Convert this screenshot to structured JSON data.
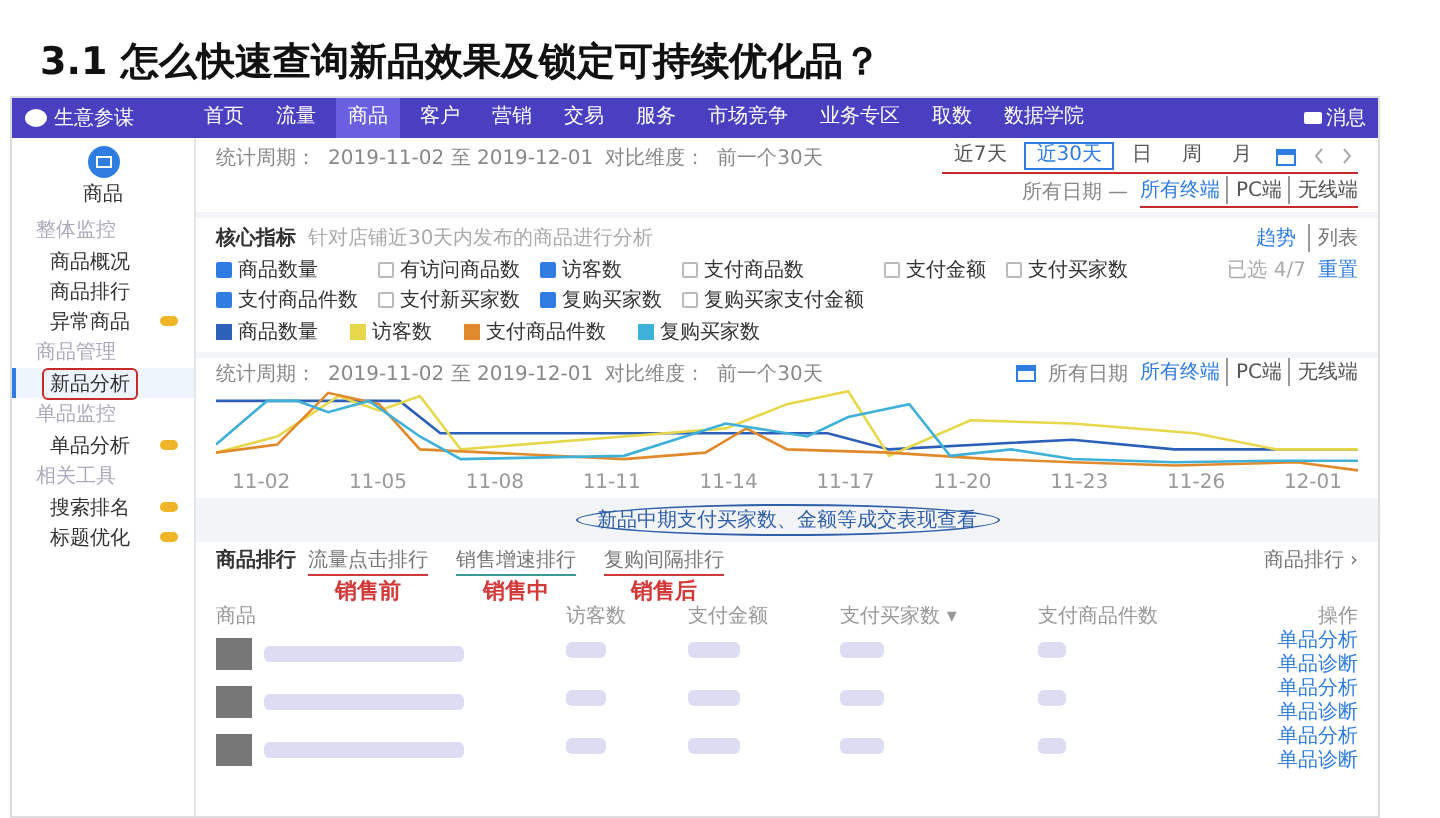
{
  "slide_title": "3.1  怎么快速查询新品效果及锁定可持续优化品？",
  "app": {
    "logo": "生意参谋",
    "messages": "消息",
    "nav": [
      {
        "label": "首页",
        "selected": false
      },
      {
        "label": "流量",
        "selected": false
      },
      {
        "label": "商品",
        "selected": true
      },
      {
        "label": "客户",
        "selected": false
      },
      {
        "label": "营销",
        "selected": false
      },
      {
        "label": "交易",
        "selected": false
      },
      {
        "label": "服务",
        "selected": false
      },
      {
        "label": "市场竞争",
        "selected": false
      },
      {
        "label": "业务专区",
        "selected": false
      },
      {
        "label": "取数",
        "selected": false
      },
      {
        "label": "数据学院",
        "selected": false
      }
    ]
  },
  "sidebar": {
    "title": "商品",
    "groups": [
      {
        "label": "整体监控",
        "items": [
          {
            "label": "商品概况",
            "selected": false,
            "badge": false
          },
          {
            "label": "商品排行",
            "selected": false,
            "badge": false
          },
          {
            "label": "异常商品",
            "selected": false,
            "badge": true
          }
        ]
      },
      {
        "label": "商品管理",
        "items": [
          {
            "label": "新品分析",
            "selected": true,
            "badge": false
          }
        ]
      },
      {
        "label": "单品监控",
        "items": [
          {
            "label": "单品分析",
            "selected": false,
            "badge": true
          }
        ]
      },
      {
        "label": "相关工具",
        "items": [
          {
            "label": "搜索排名",
            "selected": false,
            "badge": true
          },
          {
            "label": "标题优化",
            "selected": false,
            "badge": true
          }
        ]
      }
    ]
  },
  "period": {
    "range_label": "统计周期：",
    "range": "2019-11-02 至 2019-12-01",
    "compare_label": "对比维度：",
    "compare": "前一个30天",
    "quick_ranges": [
      {
        "label": "近7天",
        "selected": false
      },
      {
        "label": "近30天",
        "selected": true
      },
      {
        "label": "日",
        "selected": false
      },
      {
        "label": "周",
        "selected": false
      },
      {
        "label": "月",
        "selected": false
      }
    ],
    "quick_underlined": true,
    "dates": "所有日期 —",
    "terminals": [
      {
        "label": "所有终端",
        "selected": true
      },
      {
        "label": "PC端",
        "selected": false
      },
      {
        "label": "无线端",
        "selected": false
      }
    ],
    "terminals_underlined": true
  },
  "core": {
    "title": "核心指标",
    "subtitle": "针对店铺近30天内发布的商品进行分析",
    "views": [
      {
        "label": "趋势",
        "selected": true
      },
      {
        "label": "列表",
        "selected": false
      }
    ],
    "metrics": [
      {
        "label": "商品数量",
        "checked": true
      },
      {
        "label": "有访问商品数",
        "checked": false
      },
      {
        "label": "访客数",
        "checked": true
      },
      {
        "label": "支付商品数",
        "checked": false
      },
      {
        "label": "支付金额",
        "checked": false
      },
      {
        "label": "支付买家数",
        "checked": false
      },
      {
        "label": "支付商品件数",
        "checked": true
      },
      {
        "label": "支付新买家数",
        "checked": false
      },
      {
        "label": "复购买家数",
        "checked": true
      },
      {
        "label": "复购买家支付金额",
        "checked": false
      }
    ],
    "selected_count": "已选 4/7",
    "reset": "重置",
    "legend": [
      {
        "label": "商品数量",
        "color": "#2b5fb8"
      },
      {
        "label": "访客数",
        "color": "#e6d84a"
      },
      {
        "label": "支付商品件数",
        "color": "#e08a2c"
      },
      {
        "label": "复购买家数",
        "color": "#3fb0d8"
      }
    ]
  },
  "trend": {
    "range_label": "统计周期：",
    "range": "2019-11-02 至 2019-12-01",
    "compare_label": "对比维度：",
    "compare": "前一个30天",
    "dates": "所有日期",
    "terminals": [
      {
        "label": "所有终端",
        "selected": true
      },
      {
        "label": "PC端",
        "selected": false
      },
      {
        "label": "无线端",
        "selected": false
      }
    ],
    "x_labels": [
      "11-02",
      "11-05",
      "11-08",
      "11-11",
      "11-14",
      "11-17",
      "11-20",
      "11-23",
      "11-26",
      "12-01"
    ],
    "note": "新品中期支付买家数、金额等成交表现查看"
  },
  "ranking": {
    "title": "商品排行",
    "more": "商品排行 ›",
    "tabs": [
      {
        "label": "流量点击排行",
        "note": "销售前",
        "color": "#d23a3a"
      },
      {
        "label": "销售增速排行",
        "note": "销售中",
        "color": "#3a9a9a"
      },
      {
        "label": "复购间隔排行",
        "note": "销售后",
        "color": "#d23a3a"
      }
    ],
    "columns": [
      "商品",
      "访客数",
      "支付金额",
      "支付买家数 ▾",
      "支付商品件数",
      "操作"
    ],
    "rows": [
      {
        "actions": [
          "单品分析",
          "单品诊断"
        ]
      },
      {
        "actions": [
          "单品分析",
          "单品诊断"
        ]
      },
      {
        "actions": [
          "单品分析",
          "单品诊断"
        ]
      }
    ]
  }
}
